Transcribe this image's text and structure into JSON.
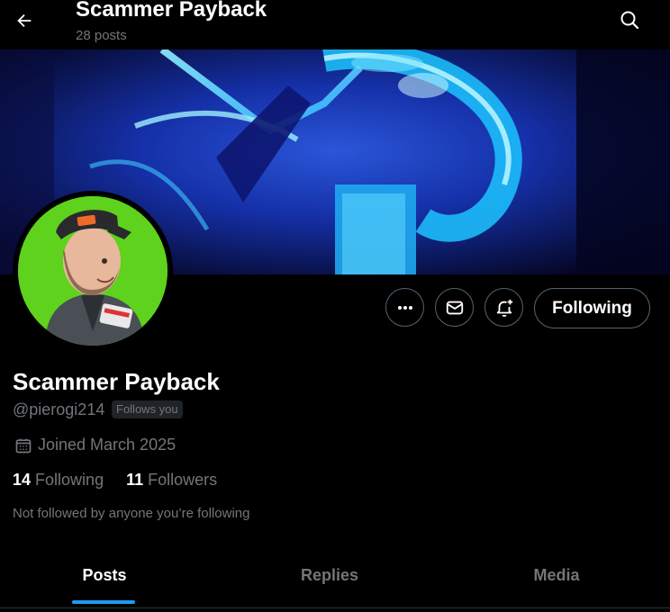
{
  "header": {
    "title": "Scammer Payback",
    "posts_count": "28 posts"
  },
  "profile": {
    "name": "Scammer Payback",
    "handle": "@pierogi214",
    "follows_you": "Follows you",
    "joined": "Joined March 2025",
    "following_count": "14",
    "following_label": "Following",
    "followers_count": "11",
    "followers_label": "Followers",
    "mutuals_note": "Not followed by anyone you’re following"
  },
  "actions": {
    "follow_button": "Following",
    "icons": [
      "more-icon",
      "message-icon",
      "notification-bell-icon"
    ]
  },
  "tabs": [
    {
      "label": "Posts",
      "active": true
    },
    {
      "label": "Replies",
      "active": false
    },
    {
      "label": "Media",
      "active": false
    }
  ],
  "colors": {
    "background": "#000000",
    "accent": "#1d9bf0",
    "secondary_text": "#71767b",
    "border": "#536471"
  }
}
